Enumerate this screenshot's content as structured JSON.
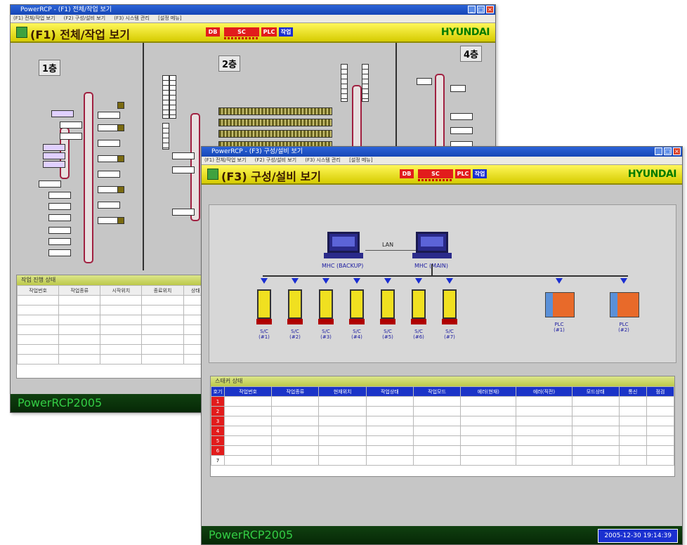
{
  "back_window": {
    "title": "PowerRCP - (F1) 전체/작업 보기",
    "menu": [
      "(F1) 전체/작업 보기",
      "(F2) 구성/설비 보기",
      "(F3) 시스템 관리",
      "[설정 메뉴]"
    ],
    "header_title": "(F1) 전체/작업 보기",
    "badges": {
      "db": "DB",
      "sc": "SC",
      "plc": "PLC",
      "work": "작업"
    },
    "brand": "HYUNDAI",
    "floors": [
      "1층",
      "2층",
      "4층"
    ],
    "status_panel": {
      "title": "작업 진행 상태",
      "columns": [
        "작업번호",
        "작업종류",
        "시작위치",
        "종료위치",
        "상태"
      ]
    },
    "footer_brand": "PowerRCP2005"
  },
  "front_window": {
    "title": "PowerRCP - (F3) 구성/설비 보기",
    "menu": [
      "(F1) 전체/작업 보기",
      "(F2) 구성/설비 보기",
      "(F3) 시스템 관리",
      "[설정 메뉴]"
    ],
    "header_title": "(F3) 구성/설비 보기",
    "badges": {
      "db": "DB",
      "sc": "SC",
      "plc": "PLC",
      "work": "작업"
    },
    "brand": "HYUNDAI",
    "network": {
      "lan_label": "LAN",
      "pcs": [
        {
          "label": "MHC (BACKUP)"
        },
        {
          "label": "MHC (MAIN)"
        }
      ],
      "srms": [
        {
          "label": "S/C",
          "unit": "(#1)"
        },
        {
          "label": "S/C",
          "unit": "(#2)"
        },
        {
          "label": "S/C",
          "unit": "(#3)"
        },
        {
          "label": "S/C",
          "unit": "(#4)"
        },
        {
          "label": "S/C",
          "unit": "(#5)"
        },
        {
          "label": "S/C",
          "unit": "(#6)"
        },
        {
          "label": "S/C",
          "unit": "(#7)"
        }
      ],
      "plcs": [
        {
          "label": "PLC",
          "unit": "(#1)"
        },
        {
          "label": "PLC",
          "unit": "(#2)"
        }
      ]
    },
    "crane_panel": {
      "title": "스태커 상태",
      "columns": [
        "호기",
        "작업번호",
        "작업종류",
        "현재위치",
        "작업상태",
        "작업모드",
        "에러(현재)",
        "에러(직전)",
        "모드상태",
        "통신",
        "점검"
      ],
      "rows": [
        "1",
        "2",
        "3",
        "4",
        "5",
        "6",
        "7"
      ]
    },
    "footer_brand": "PowerRCP2005",
    "clock": "2005-12-30 19:14:39"
  },
  "colors": {
    "header_yellow": "#f2ea2a",
    "badge_red": "#e21c1c",
    "badge_blue": "#1a2ed2",
    "footer_green": "#33cc44",
    "brand_green": "#007a00"
  }
}
